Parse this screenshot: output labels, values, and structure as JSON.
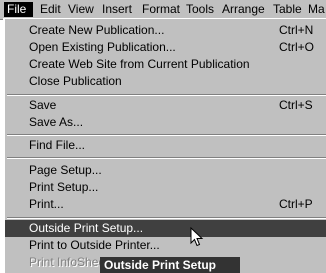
{
  "menubar": {
    "file": "File",
    "edit": "Edit",
    "view": "View",
    "insert": "Insert",
    "format": "Format",
    "tools": "Tools",
    "arrange": "Arrange",
    "table": "Table",
    "ma": "Ma"
  },
  "file_menu": {
    "create_new": {
      "label": "Create New Publication...",
      "accel": "Ctrl+N"
    },
    "open_existing": {
      "label": "Open Existing Publication...",
      "accel": "Ctrl+O"
    },
    "create_web_site": {
      "label": "Create Web Site from Current Publication"
    },
    "close_publication": {
      "label": "Close Publication"
    },
    "save": {
      "label": "Save",
      "accel": "Ctrl+S"
    },
    "save_as": {
      "label": "Save As..."
    },
    "find_file": {
      "label": "Find File..."
    },
    "page_setup": {
      "label": "Page Setup..."
    },
    "print_setup": {
      "label": "Print Setup..."
    },
    "print": {
      "label": "Print...",
      "accel": "Ctrl+P"
    },
    "outside_print_setup": {
      "label": "Outside Print Setup..."
    },
    "print_to_outside_printer": {
      "label": "Print to Outside Printer..."
    },
    "print_infosheet": {
      "label": "Print InfoSheet"
    }
  },
  "tooltip": {
    "text": "Outside Print Setup"
  },
  "colors": {
    "menu_bg": "#c0c0c0",
    "highlight_bg": "#404040",
    "highlight_text": "#ffffff",
    "disabled_text": "#808080",
    "tooltip_bg": "#333333"
  },
  "icons": {
    "cursor": "mouse-pointer-icon"
  }
}
